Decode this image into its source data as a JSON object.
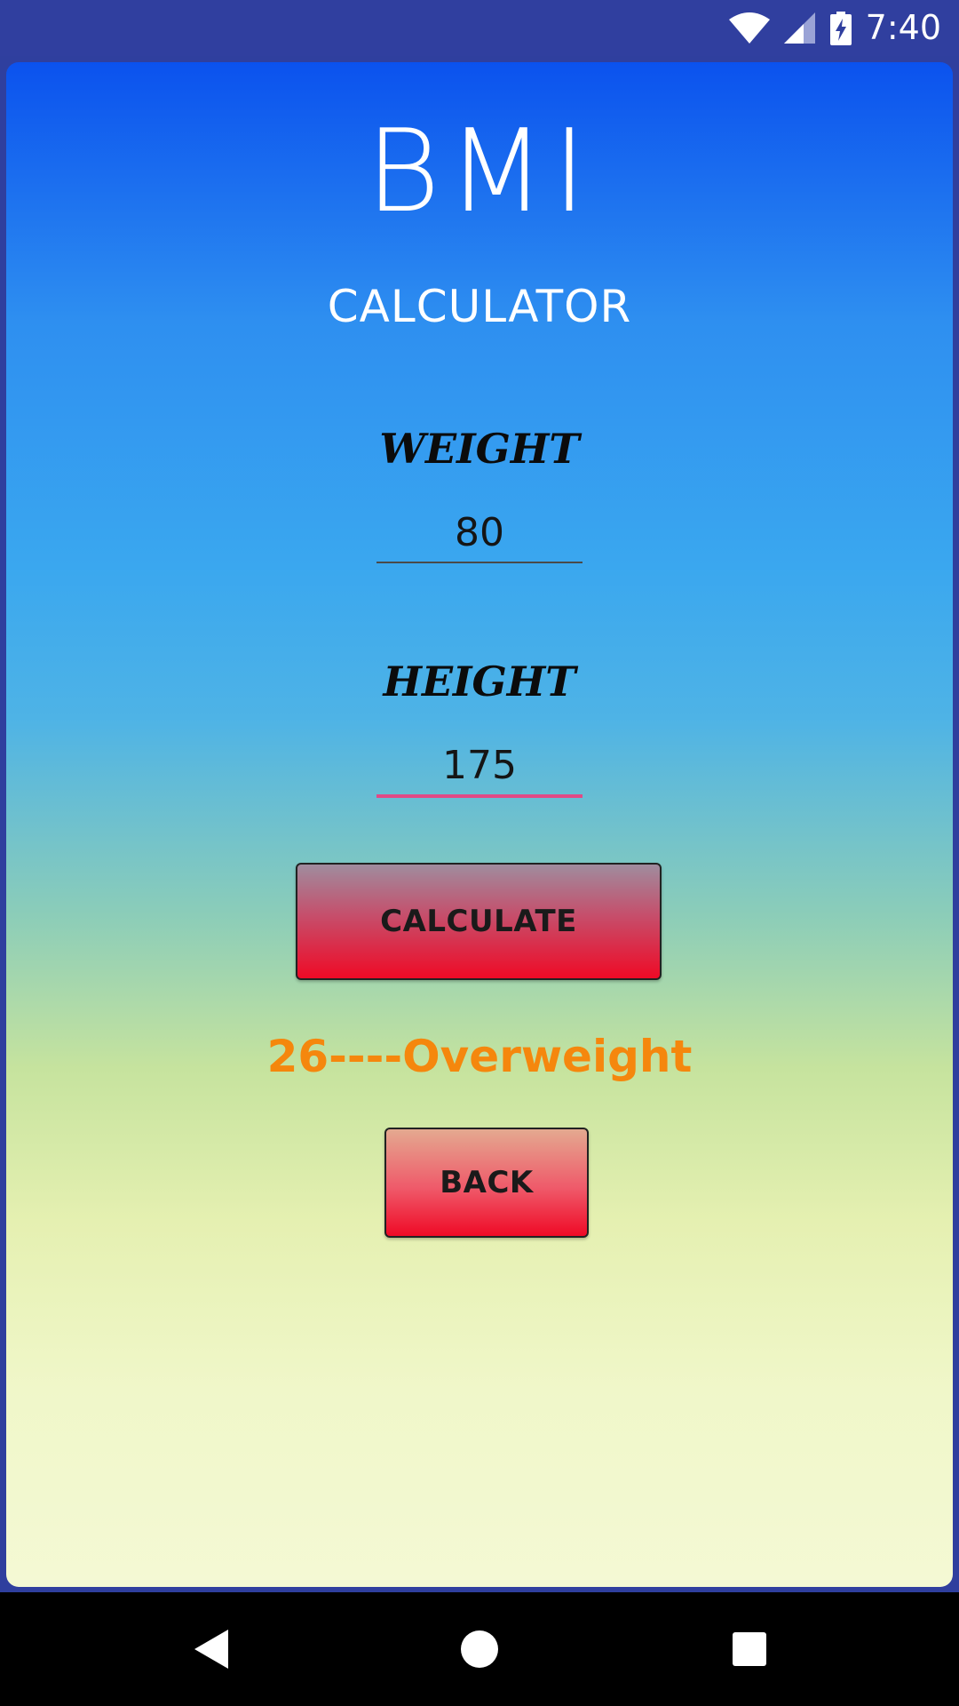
{
  "status_bar": {
    "time": "7:40",
    "icons": [
      "wifi-icon",
      "signal-icon",
      "battery-charging-icon"
    ],
    "background_color": "#303f9f"
  },
  "app": {
    "title": "BMI",
    "subtitle": "CALCULATOR",
    "weight": {
      "label": "WEIGHT",
      "value": "80"
    },
    "height": {
      "label": "HEIGHT",
      "value": "175"
    },
    "calculate_button_label": "CALCULATE",
    "result": "26----Overweight",
    "back_button_label": "BACK",
    "colors": {
      "result_text": "#f5870d",
      "button_red": "#ef0a26",
      "focused_underline": "#e14a86"
    }
  },
  "nav_bar": {
    "icons": [
      "back-icon",
      "home-icon",
      "recents-icon"
    ]
  }
}
